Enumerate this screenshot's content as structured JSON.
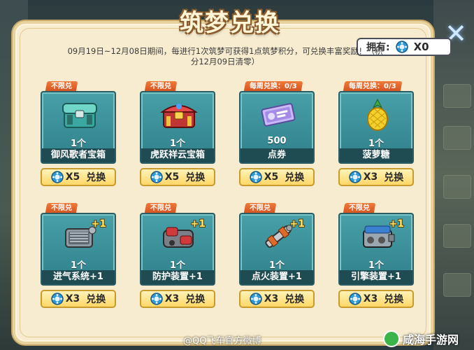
{
  "title": "筑梦兑换",
  "owned": {
    "label": "拥有:",
    "value": "X0"
  },
  "description": "09月19日~12月08日期间，每进行1次筑梦可获得1点筑梦积分，可兑换丰富奖励！（积分12月09日清零）",
  "items": [
    {
      "badge": "不限兑",
      "qty": "1个",
      "name": "御风歌者宝箱",
      "cost": "X5",
      "action": "兑换",
      "art": "chest-teal",
      "plus": ""
    },
    {
      "badge": "不限兑",
      "qty": "1个",
      "name": "虎跃祥云宝箱",
      "cost": "X5",
      "action": "兑换",
      "art": "chest-red",
      "plus": ""
    },
    {
      "badge": "每周兑换：0/3",
      "qty": "500",
      "name": "点券",
      "cost": "X5",
      "action": "兑换",
      "art": "ticket",
      "plus": ""
    },
    {
      "badge": "每周兑换：0/3",
      "qty": "1个",
      "name": "菠萝糖",
      "cost": "X3",
      "action": "兑换",
      "art": "pineapple",
      "plus": ""
    },
    {
      "badge": "不限兑",
      "qty": "1个",
      "name": "进气系统+1",
      "cost": "X3",
      "action": "兑换",
      "art": "intake",
      "plus": "+1"
    },
    {
      "badge": "不限兑",
      "qty": "1个",
      "name": "防护装置+1",
      "cost": "X3",
      "action": "兑换",
      "art": "guard",
      "plus": "+1"
    },
    {
      "badge": "不限兑",
      "qty": "1个",
      "name": "点火装置+1",
      "cost": "X3",
      "action": "兑换",
      "art": "ignition",
      "plus": "+1"
    },
    {
      "badge": "不限兑",
      "qty": "1个",
      "name": "引擎装置+1",
      "cost": "X3",
      "action": "兑换",
      "art": "engine",
      "plus": "+1"
    }
  ],
  "watermark": "@QQ飞车官方微博",
  "watermark2": "咸海手游网"
}
